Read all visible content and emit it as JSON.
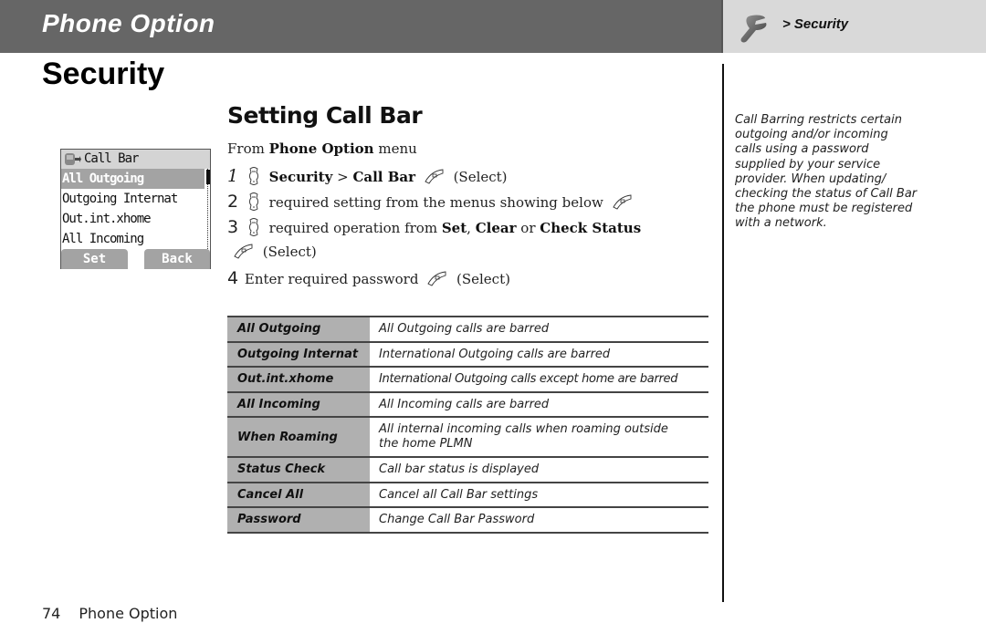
{
  "header": {
    "title": "Phone Option",
    "breadcrumb": "> Security",
    "breadcrumb_icon": "wrench-icon",
    "colors": {
      "bar": "#666666",
      "right_panel": "#d9d9d9"
    }
  },
  "page_title": "Security",
  "section": {
    "title": "Setting Call Bar",
    "intro": {
      "prefix": "From ",
      "bold": "Phone Option",
      "suffix": " menu"
    },
    "steps": [
      {
        "num": "1",
        "parts": [
          "Security",
          " > ",
          "Call Bar",
          "(Select)"
        ]
      },
      {
        "num": "2",
        "text": "required setting from the menus showing below"
      },
      {
        "num": "3",
        "text_a": "required operation from ",
        "b1": "Set",
        "sep1": ", ",
        "b2": "Clear",
        "sep2": " or ",
        "b3": "Check Status",
        "cont": "(Select)"
      },
      {
        "num": "4",
        "text": "Enter required password",
        "tail": "(Select)"
      }
    ]
  },
  "phone_screen": {
    "title": "Call Bar",
    "items": [
      "All Outgoing",
      "Outgoing Internat",
      "Out.int.xhome",
      "All Incoming"
    ],
    "selected_index": 0,
    "softkeys": {
      "left": "Set",
      "right": "Back"
    }
  },
  "options_table": [
    {
      "key": "All Outgoing",
      "value": "All Outgoing calls are barred"
    },
    {
      "key": "Outgoing Internat",
      "value": "International Outgoing calls are barred"
    },
    {
      "key": "Out.int.xhome",
      "value": "International Outgoing calls except home are barred"
    },
    {
      "key": "All Incoming",
      "value": "All Incoming calls are barred"
    },
    {
      "key": "When Roaming",
      "value": "All internal incoming calls when roaming outside the home PLMN"
    },
    {
      "key": "Status Check",
      "value": "Call bar status is displayed"
    },
    {
      "key": "Cancel All",
      "value": "Cancel all Call Bar settings"
    },
    {
      "key": "Password",
      "value": "Change Call Bar Password"
    }
  ],
  "side_note": "Call Barring restricts certain outgoing and/or incoming calls using a password supplied by your service provider. When updating/ checking the status of Call Bar the phone must be registered with a network.",
  "footer": {
    "page_number": "74",
    "section": "Phone Option"
  }
}
